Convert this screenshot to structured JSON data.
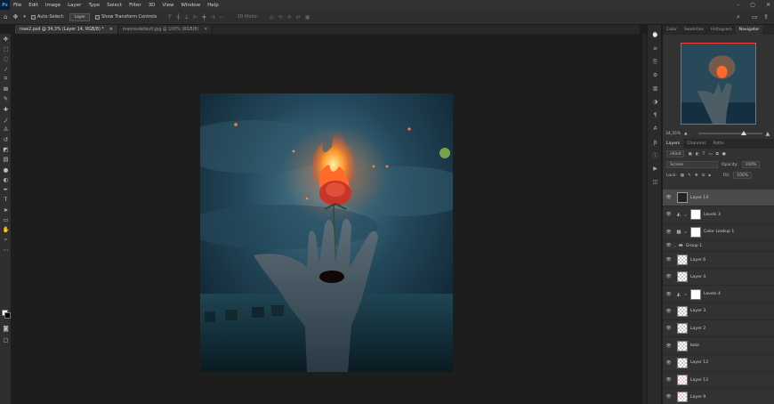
{
  "app": {
    "logo": "Ps"
  },
  "menu": [
    "File",
    "Edit",
    "Image",
    "Layer",
    "Type",
    "Select",
    "Filter",
    "3D",
    "View",
    "Window",
    "Help"
  ],
  "window_controls": {
    "minimize": "–",
    "maximize": "▢",
    "close": "✕"
  },
  "options": {
    "auto_select_label": "Auto-Select:",
    "auto_select_target": "Layer",
    "transform_label": "Show Transform Controls",
    "mode_3d": "3D Mode:"
  },
  "tabs": [
    {
      "label": "rose2.psd @ 34,3% (Layer 14, RGB/8) *",
      "close": "✕"
    },
    {
      "label": "maxresdefault.jpg @ 100% (RGB/8)",
      "close": "✕"
    }
  ],
  "panels": {
    "top_tabs": [
      "Color",
      "Swatches",
      "Histogram",
      "Navigator"
    ],
    "zoom": "34,35%",
    "layer_tabs": [
      "Layers",
      "Channels",
      "Paths"
    ],
    "kind": "Kind",
    "blend_mode": "Screen",
    "opacity_label": "Opacity:",
    "opacity_value": "100%",
    "lock_label": "Lock:",
    "fill_label": "Fill:",
    "fill_value": "100%"
  },
  "layers": [
    {
      "name": "Layer 14",
      "thumb": "dark",
      "selected": true
    },
    {
      "name": "Levels 3",
      "thumb": "white",
      "adj": "levels"
    },
    {
      "name": "Color Lookup 1",
      "thumb": "white",
      "adj": "lookup"
    },
    {
      "name": "Group 1",
      "group": true
    },
    {
      "name": "Layer 6",
      "thumb": "checker"
    },
    {
      "name": "Layer 4",
      "thumb": "checker"
    },
    {
      "name": "Levels 4",
      "thumb": "white",
      "adj": "levels"
    },
    {
      "name": "Layer 3",
      "thumb": "checker"
    },
    {
      "name": "Layer 2",
      "thumb": "checker"
    },
    {
      "name": "bala",
      "thumb": "checker"
    },
    {
      "name": "Layer 12",
      "thumb": "checker"
    },
    {
      "name": "Layer 12",
      "thumb": "red"
    },
    {
      "name": "Layer 9",
      "thumb": "red"
    }
  ]
}
